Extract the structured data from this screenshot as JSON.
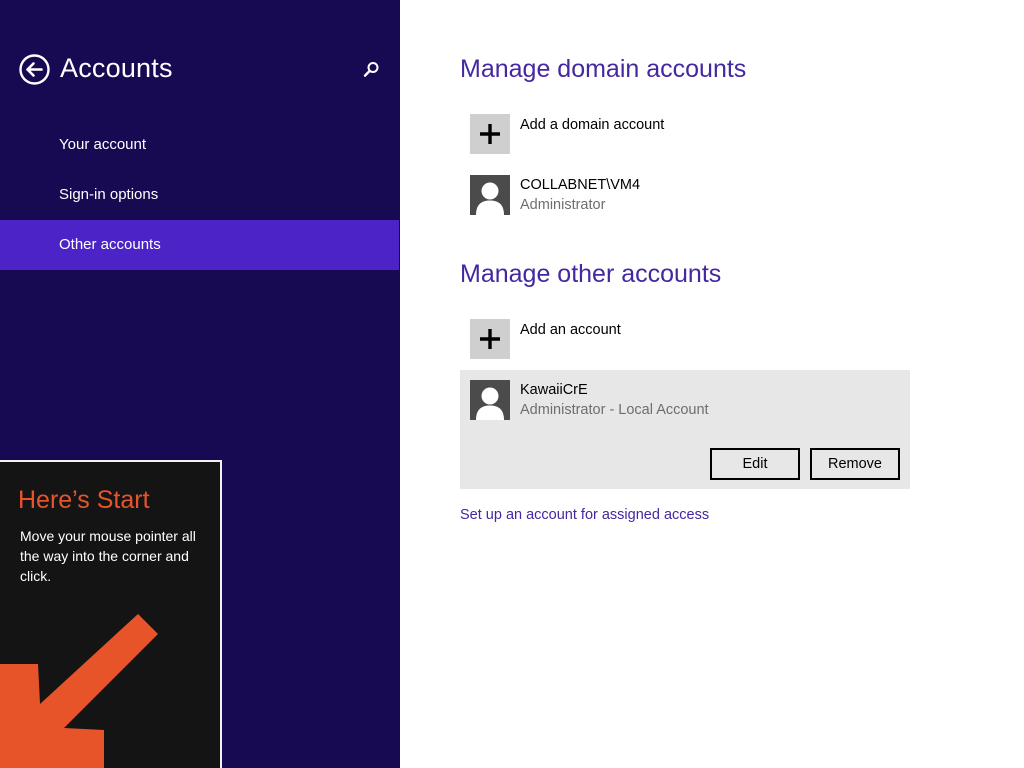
{
  "colors": {
    "nav_background": "#180a52",
    "nav_selected": "#4c23c6",
    "accent_text": "#4527a0",
    "tip_accent": "#e8542a"
  },
  "nav": {
    "title": "Accounts",
    "back_icon": "back-arrow-circle-icon",
    "search_icon": "search-icon",
    "items": [
      {
        "label": "Your account",
        "selected": false
      },
      {
        "label": "Sign-in options",
        "selected": false
      },
      {
        "label": "Other accounts",
        "selected": true
      }
    ]
  },
  "start_tip": {
    "title": "Here’s Start",
    "body": "Move your mouse pointer all the way into the corner and click."
  },
  "domain_accounts": {
    "title": "Manage domain accounts",
    "add_label": "Add a domain account",
    "accounts": [
      {
        "name": "COLLABNET\\VM4",
        "role": "Administrator"
      }
    ]
  },
  "other_accounts": {
    "title": "Manage other accounts",
    "add_label": "Add an account",
    "accounts": [
      {
        "name": "KawaiiCrE",
        "role": "Administrator - Local Account",
        "edit_label": "Edit",
        "remove_label": "Remove",
        "expanded": true
      }
    ],
    "assigned_access_link": "Set up an account for assigned access"
  }
}
